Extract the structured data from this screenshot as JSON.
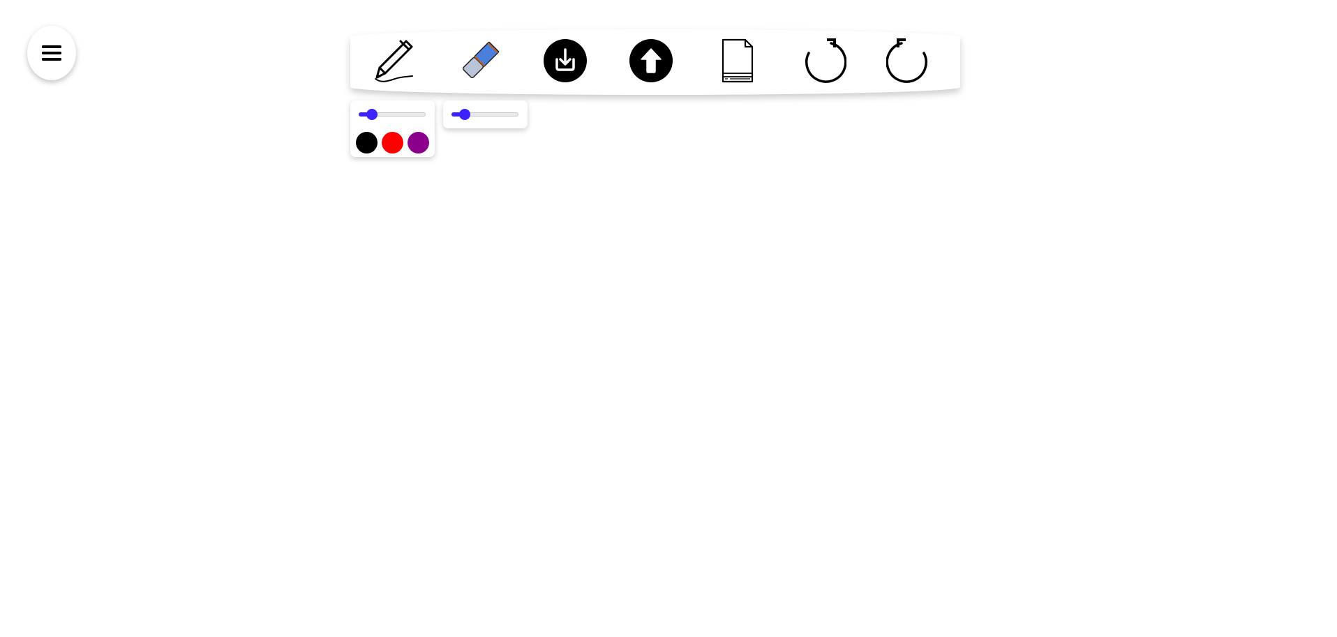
{
  "menu": {
    "icon": "hamburger-menu-icon"
  },
  "toolbar": {
    "tools": [
      {
        "name": "pencil",
        "icon": "pencil-icon"
      },
      {
        "name": "eraser",
        "icon": "eraser-icon"
      },
      {
        "name": "save",
        "icon": "download-icon"
      },
      {
        "name": "upload",
        "icon": "upload-icon"
      },
      {
        "name": "new-page",
        "icon": "blank-page-icon"
      },
      {
        "name": "undo",
        "icon": "undo-icon"
      },
      {
        "name": "redo",
        "icon": "redo-icon"
      }
    ]
  },
  "pen_panel": {
    "size_slider": {
      "value": 0.2,
      "accent": "#3b22ff"
    },
    "colors": [
      "#000000",
      "#ff0000",
      "#8b008b"
    ]
  },
  "eraser_panel": {
    "size_slider": {
      "value": 0.2,
      "accent": "#3b22ff"
    }
  }
}
